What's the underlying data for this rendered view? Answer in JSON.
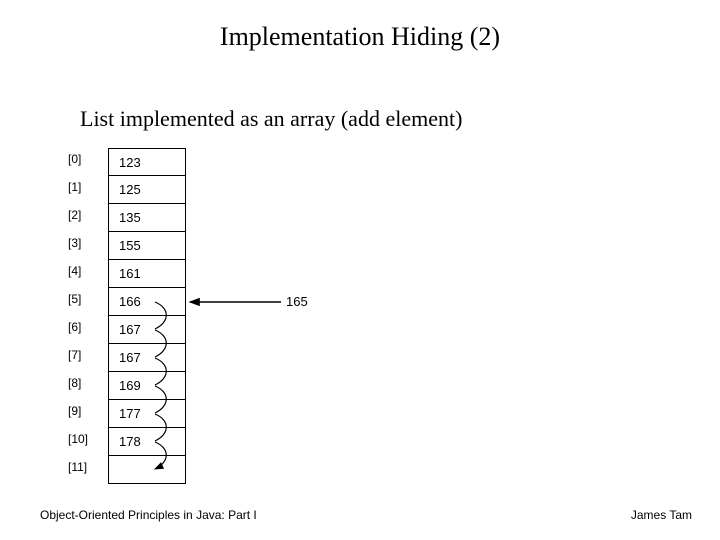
{
  "title": "Implementation Hiding (2)",
  "subtitle": "List implemented as an array (add element)",
  "array": {
    "rows": [
      {
        "index": "[0]",
        "value": "123"
      },
      {
        "index": "[1]",
        "value": "125"
      },
      {
        "index": "[2]",
        "value": "135"
      },
      {
        "index": "[3]",
        "value": "155"
      },
      {
        "index": "[4]",
        "value": "161"
      },
      {
        "index": "[5]",
        "value": "166"
      },
      {
        "index": "[6]",
        "value": "167"
      },
      {
        "index": "[7]",
        "value": "167"
      },
      {
        "index": "[8]",
        "value": "169"
      },
      {
        "index": "[9]",
        "value": "177"
      },
      {
        "index": "[10]",
        "value": "178"
      },
      {
        "index": "[11]",
        "value": ""
      }
    ]
  },
  "insert_value": "165",
  "footer": {
    "left": "Object-Oriented Principles in Java: Part I",
    "right": "James Tam"
  }
}
